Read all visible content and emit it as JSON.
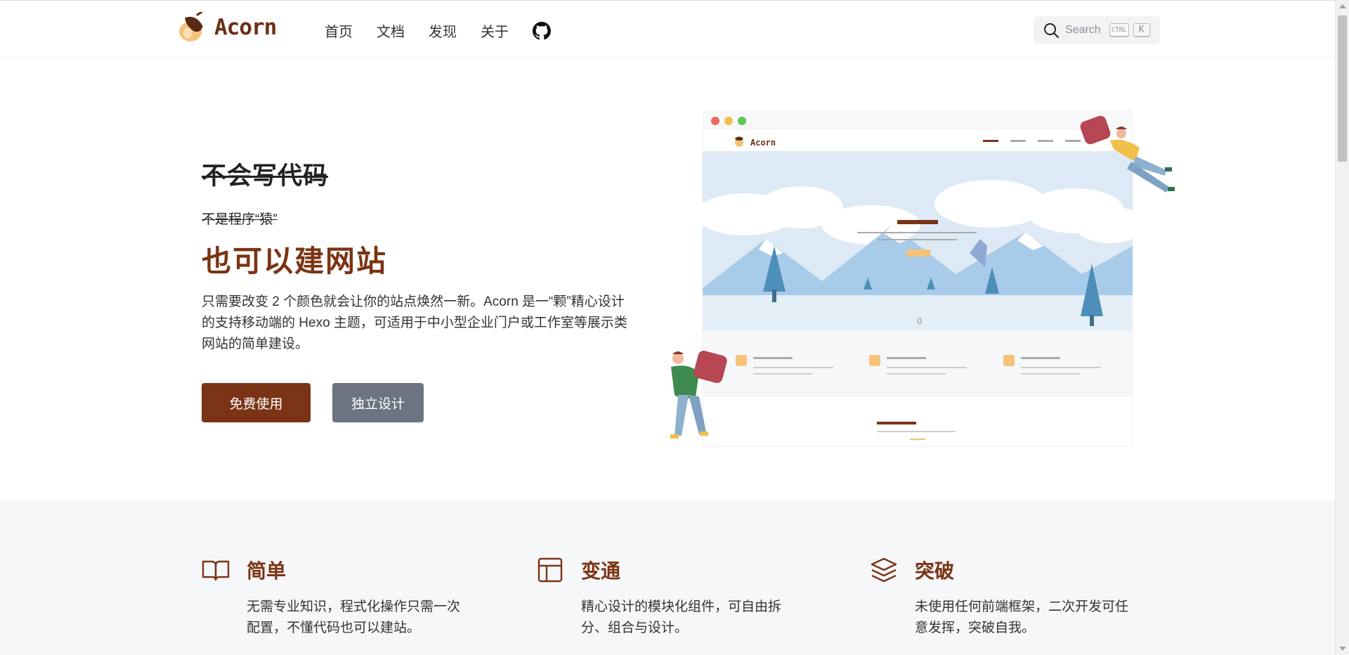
{
  "brand": {
    "name": "Acorn"
  },
  "nav": {
    "items": [
      "首页",
      "文档",
      "发现",
      "关于"
    ]
  },
  "search": {
    "label": "Search",
    "key1": "CTRL",
    "key2": "K"
  },
  "hero": {
    "line1": "不会写代码",
    "line2": "不是程序“猿”",
    "line3": "也可以建网站",
    "description": "只需要改变 2 个颜色就会让你的站点焕然一新。Acorn 是一“颗”精心设计的支持移动端的 Hexo 主题，可适用于中小型企业门户或工作室等展示类网站的简单建设。",
    "primary_button": "免费使用",
    "secondary_button": "独立设计"
  },
  "illustration": {
    "brand": "Acorn",
    "counter": "0"
  },
  "features": [
    {
      "icon": "book-open-icon",
      "title": "简单",
      "description": "无需专业知识，程式化操作只需一次配置，不懂代码也可以建站。"
    },
    {
      "icon": "layout-icon",
      "title": "变通",
      "description": "精心设计的模块化组件，可自由拆分、组合与设计。"
    },
    {
      "icon": "layers-icon",
      "title": "突破",
      "description": "未使用任何前端框架，二次开发可任意发挥，突破自我。"
    }
  ],
  "colors": {
    "brand": "#7a3315",
    "secondary": "#6b7480",
    "accent": "#f5c27a",
    "background_alt": "#f6f7f9"
  }
}
